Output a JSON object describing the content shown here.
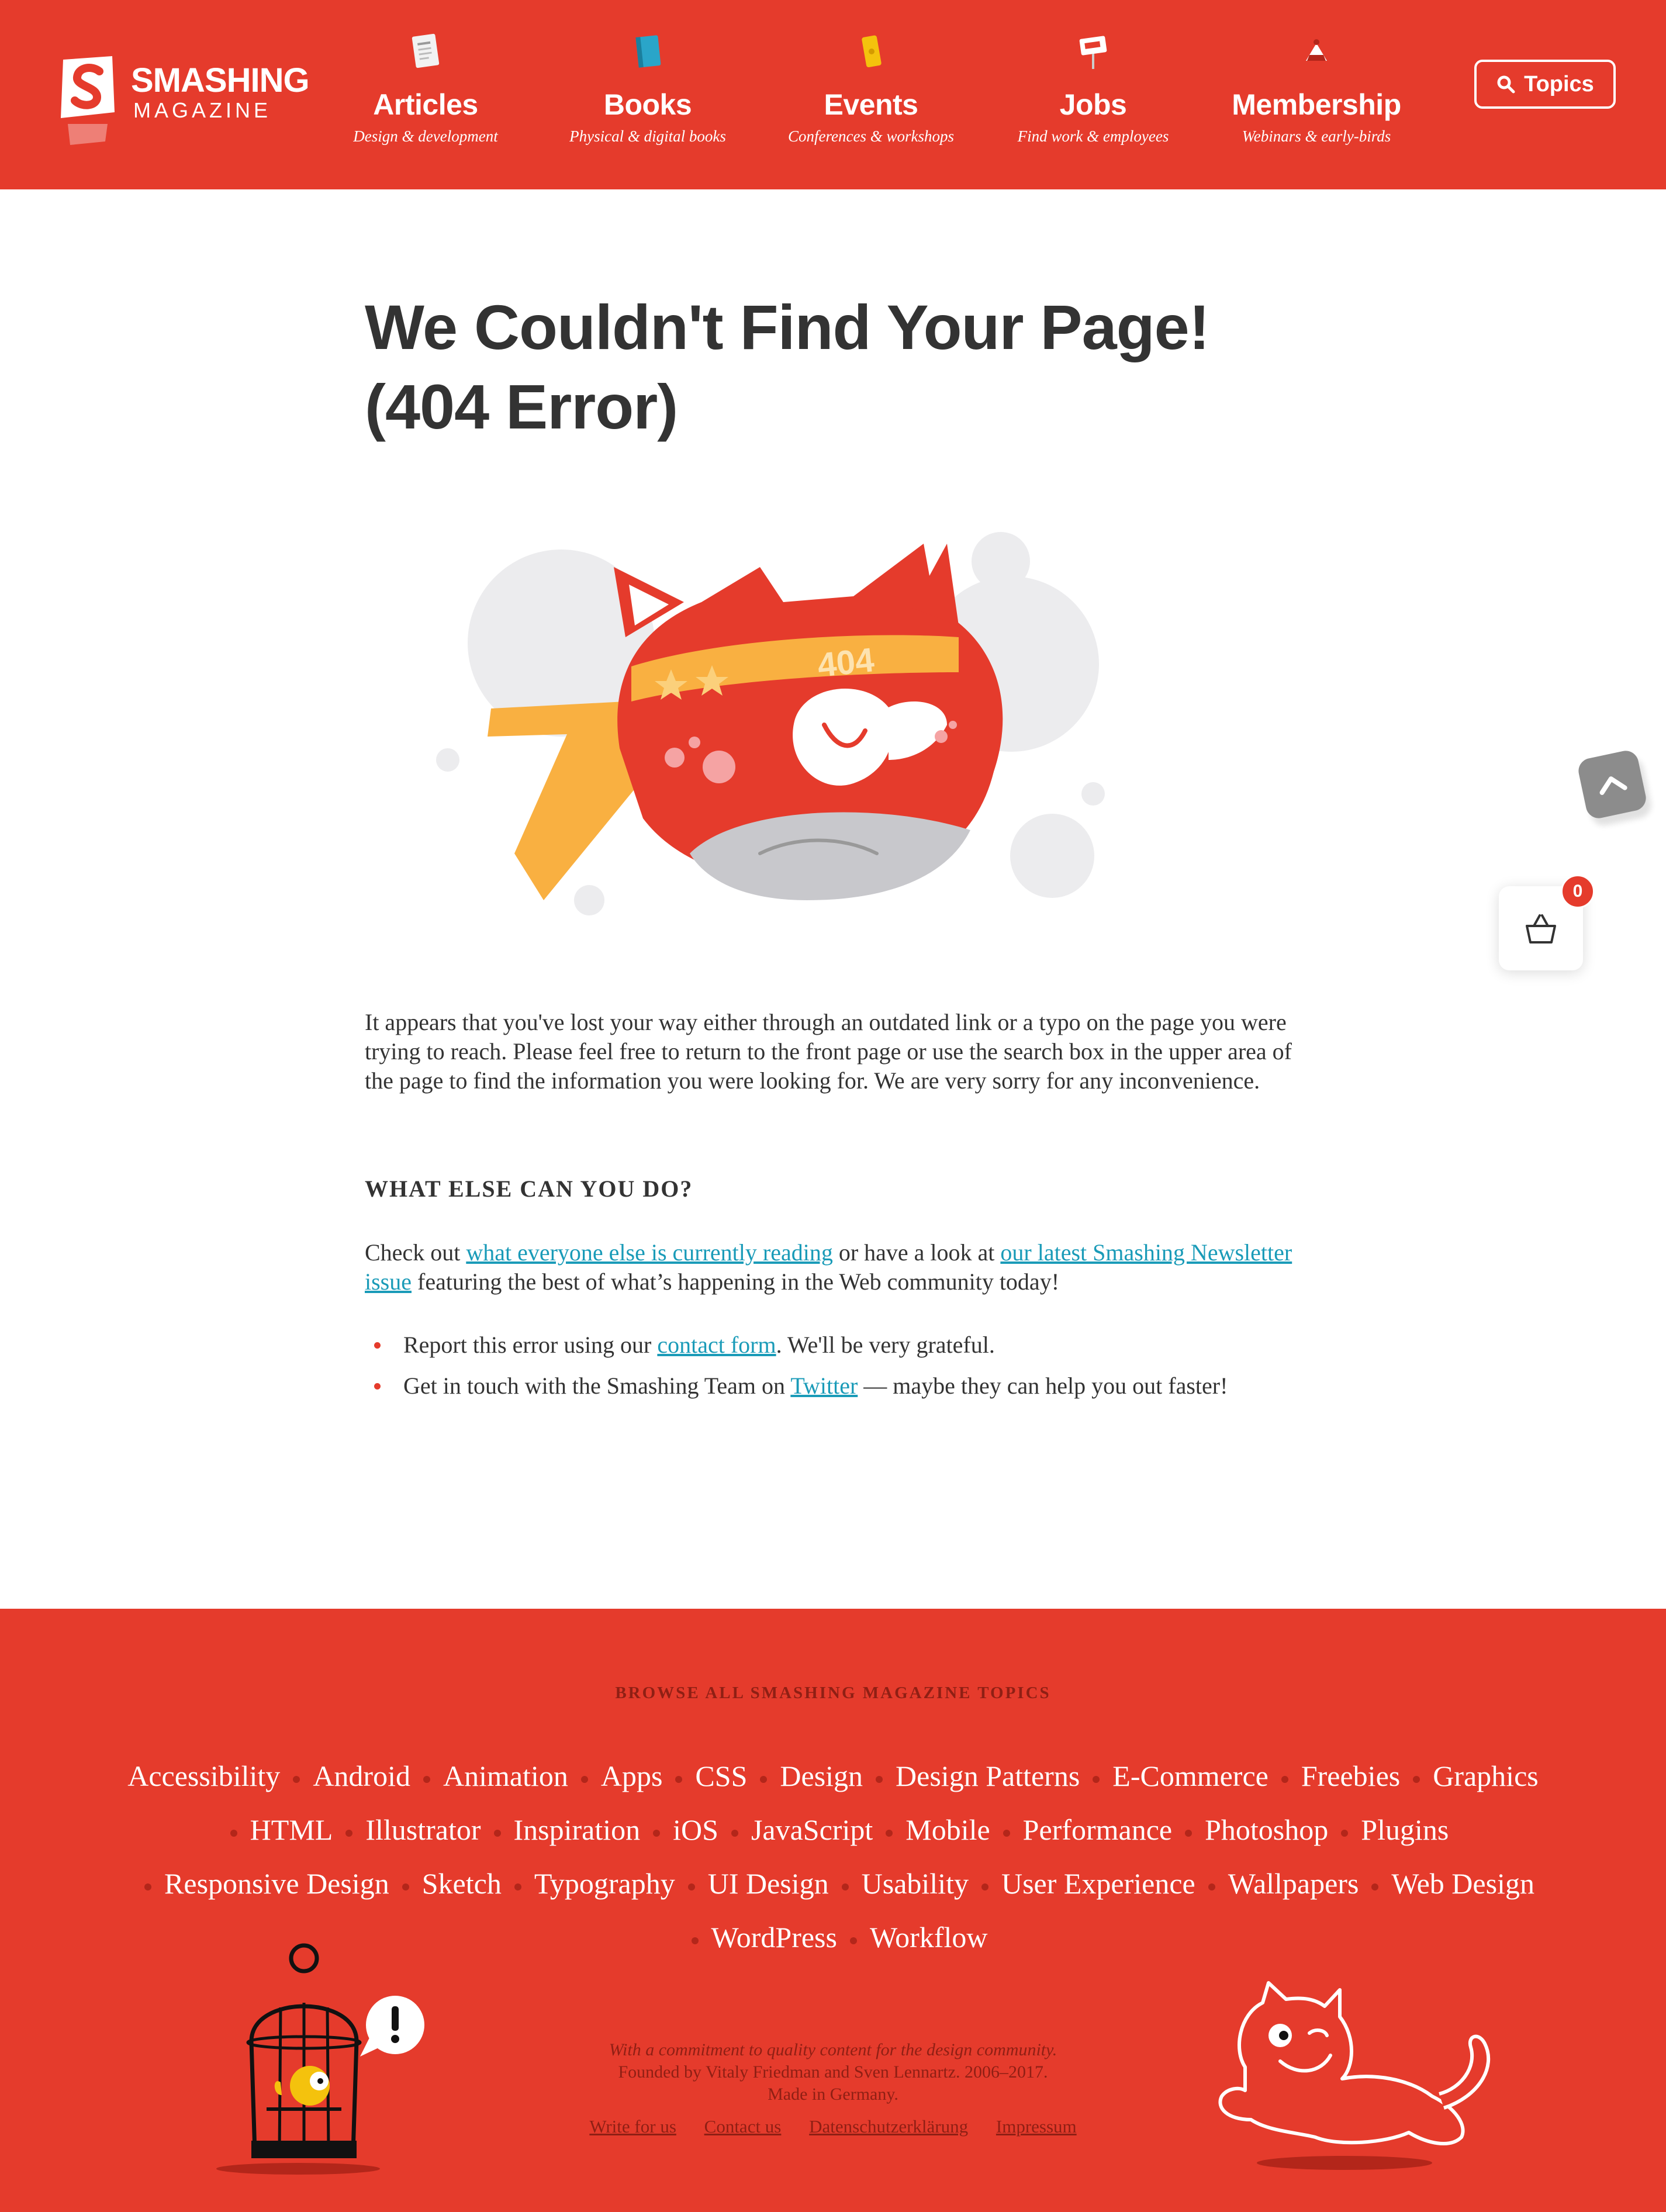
{
  "header": {
    "logo_word": "SMASHING",
    "logo_sub": "MAGAZINE",
    "nav": [
      {
        "label": "Articles",
        "sub": "Design & development",
        "icon": "article-icon"
      },
      {
        "label": "Books",
        "sub": "Physical & digital books",
        "icon": "book-icon"
      },
      {
        "label": "Events",
        "sub": "Conferences & workshops",
        "icon": "ticket-icon"
      },
      {
        "label": "Jobs",
        "sub": "Find work & employees",
        "icon": "open-sign-icon"
      },
      {
        "label": "Membership",
        "sub": "Webinars & early-birds",
        "icon": "cake-icon"
      }
    ],
    "topics_button": "Topics"
  },
  "main": {
    "title": "We Couldn't Find Your Page! (404 Error)",
    "illustration_text": "404",
    "intro": "It appears that you've lost your way either through an outdated link or a typo on the page you were trying to reach. Please feel free to return to the front page or use the search box in the upper area of the page to find the information you were looking for. We are very sorry for any inconvenience.",
    "section_heading": "WHAT ELSE CAN YOU DO?",
    "para2": {
      "t1": "Check out ",
      "link1": "what everyone else is currently reading",
      "t2": " or have a look at ",
      "link2": "our latest Smashing Newsletter issue",
      "t3": " featuring the best of what’s happening in the Web community today!"
    },
    "list": [
      {
        "pre": "Report this error using our ",
        "link": "contact form",
        "post": ". We'll be very grateful."
      },
      {
        "pre": "Get in touch with the Smashing Team on ",
        "link": "Twitter",
        "post": " — maybe they can help you out faster!"
      }
    ]
  },
  "widgets": {
    "cart_count": "0"
  },
  "footer": {
    "heading": "BROWSE ALL SMASHING MAGAZINE TOPICS",
    "topics": [
      "Accessibility",
      "Android",
      "Animation",
      "Apps",
      "CSS",
      "Design",
      "Design Patterns",
      "E-Commerce",
      "Freebies",
      "Graphics",
      "HTML",
      "Illustrator",
      "Inspiration",
      "iOS",
      "JavaScript",
      "Mobile",
      "Performance",
      "Photoshop",
      "Plugins",
      "Responsive Design",
      "Sketch",
      "Typography",
      "UI Design",
      "Usability",
      "User Experience",
      "Wallpapers",
      "Web Design",
      "WordPress",
      "Workflow"
    ],
    "tagline1": "With a commitment to quality content for the design community.",
    "tagline2": "Founded by Vitaly Friedman and Sven Lennartz. 2006–2017.",
    "tagline3": "Made in Germany.",
    "links": [
      "Write for us",
      "Contact us",
      "Datenschutzerklärung",
      "Impressum"
    ]
  }
}
